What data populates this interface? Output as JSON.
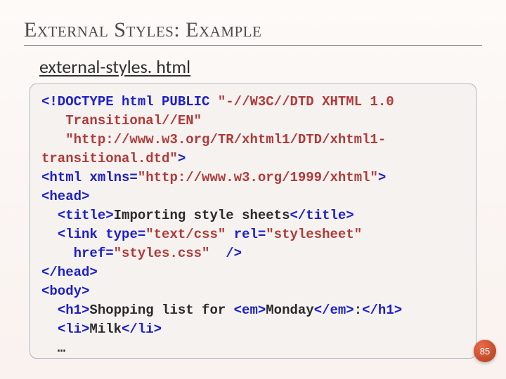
{
  "title": "External Styles: Example",
  "subtitle": "external-styles. html",
  "code_lines": [
    [
      {
        "t": "<!DOCTYPE html PUBLIC",
        "c": "kw"
      },
      {
        "t": " ",
        "c": "txt"
      },
      {
        "t": "\"-//W3C//DTD XHTML 1.0",
        "c": "str"
      }
    ],
    [
      {
        "t": "   ",
        "c": "txt"
      },
      {
        "t": "Transitional//EN\"",
        "c": "str"
      }
    ],
    [
      {
        "t": "   ",
        "c": "txt"
      },
      {
        "t": "\"http://www.w3.org/TR/xhtml1/DTD/xhtml1-",
        "c": "str"
      }
    ],
    [
      {
        "t": "transitional.dtd\"",
        "c": "str"
      },
      {
        "t": ">",
        "c": "kw"
      }
    ],
    [
      {
        "t": "<html",
        "c": "kw"
      },
      {
        "t": " ",
        "c": "txt"
      },
      {
        "t": "xmlns=",
        "c": "kw"
      },
      {
        "t": "\"http://www.w3.org/1999/xhtml\"",
        "c": "str"
      },
      {
        "t": ">",
        "c": "kw"
      }
    ],
    [
      {
        "t": "<head>",
        "c": "kw"
      }
    ],
    [
      {
        "t": "  ",
        "c": "txt"
      },
      {
        "t": "<title>",
        "c": "kw"
      },
      {
        "t": "Importing style sheets",
        "c": "txt"
      },
      {
        "t": "</title>",
        "c": "kw"
      }
    ],
    [
      {
        "t": "  ",
        "c": "txt"
      },
      {
        "t": "<link",
        "c": "kw"
      },
      {
        "t": " ",
        "c": "txt"
      },
      {
        "t": "type=",
        "c": "kw"
      },
      {
        "t": "\"text/css\"",
        "c": "str"
      },
      {
        "t": " ",
        "c": "txt"
      },
      {
        "t": "rel=",
        "c": "kw"
      },
      {
        "t": "\"stylesheet\"",
        "c": "str"
      }
    ],
    [
      {
        "t": "    ",
        "c": "txt"
      },
      {
        "t": "href=",
        "c": "kw"
      },
      {
        "t": "\"styles.css\"",
        "c": "str"
      },
      {
        "t": "  ",
        "c": "txt"
      },
      {
        "t": "/>",
        "c": "kw"
      }
    ],
    [
      {
        "t": "</head>",
        "c": "kw"
      }
    ],
    [
      {
        "t": "<body>",
        "c": "kw"
      }
    ],
    [
      {
        "t": "  ",
        "c": "txt"
      },
      {
        "t": "<h1>",
        "c": "kw"
      },
      {
        "t": "Shopping list for ",
        "c": "txt"
      },
      {
        "t": "<em>",
        "c": "kw"
      },
      {
        "t": "Monday",
        "c": "txt"
      },
      {
        "t": "</em>",
        "c": "kw"
      },
      {
        "t": ":",
        "c": "txt"
      },
      {
        "t": "</h1>",
        "c": "kw"
      }
    ],
    [
      {
        "t": "  ",
        "c": "txt"
      },
      {
        "t": "<li>",
        "c": "kw"
      },
      {
        "t": "Milk",
        "c": "txt"
      },
      {
        "t": "</li>",
        "c": "kw"
      }
    ],
    [
      {
        "t": "  …",
        "c": "txt"
      }
    ]
  ],
  "page_number": "85"
}
